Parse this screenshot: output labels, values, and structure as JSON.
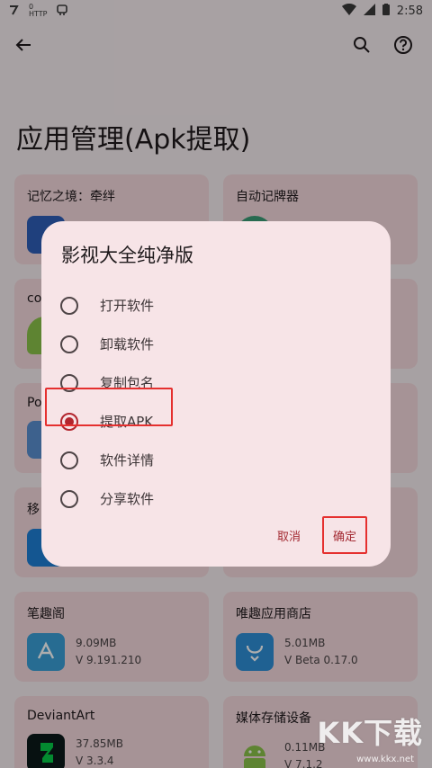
{
  "status_bar": {
    "time": "2:58",
    "left_icons": [
      "notification-icon",
      "net-speed-icon",
      "app-notif-icon"
    ],
    "net_speed": "0\nHTTP"
  },
  "app_bar": {
    "back_icon": "arrow-back-icon",
    "search_icon": "search-icon",
    "help_icon": "help-icon"
  },
  "page": {
    "title": "应用管理(Apk提取)"
  },
  "cards": [
    {
      "name": "记忆之境：牵绊",
      "size": "",
      "version": "",
      "icon_color": "#2f5fb8"
    },
    {
      "name": "自动记牌器",
      "size": "",
      "version": "",
      "icon_color": "#3a9c76"
    },
    {
      "name": "co",
      "size": "",
      "version": "",
      "icon_color": "#8bc34a"
    },
    {
      "name": "",
      "size": "",
      "version": "",
      "icon_color": "#8bc34a"
    },
    {
      "name": "Po",
      "size": "",
      "version": "",
      "icon_color": "#5b8fd0"
    },
    {
      "name": "",
      "size": "",
      "version": "",
      "icon_color": "#999"
    },
    {
      "name": "移",
      "size": "",
      "version": "",
      "icon_color": "#1e7fd6"
    },
    {
      "name": "",
      "size": "",
      "version": "",
      "icon_color": "#999"
    },
    {
      "name": "笔趣阁",
      "size": "9.09MB",
      "version": "V 9.191.210",
      "icon_color": "#3aa0d8"
    },
    {
      "name": "唯趣应用商店",
      "size": "5.01MB",
      "version": "V Beta 0.17.0",
      "icon_color": "#2f8fd8"
    },
    {
      "name": "DeviantArt",
      "size": "37.85MB",
      "version": "V 3.3.4",
      "icon_color": "#0b1a1a"
    },
    {
      "name": "媒体存储设备",
      "size": "0.11MB",
      "version": "V 7.1.2",
      "icon_color": "#8bc34a"
    }
  ],
  "dialog": {
    "title": "影视大全纯净版",
    "options": [
      {
        "label": "打开软件",
        "checked": false
      },
      {
        "label": "卸载软件",
        "checked": false
      },
      {
        "label": "复制包名",
        "checked": false
      },
      {
        "label": "提取APK",
        "checked": true
      },
      {
        "label": "软件详情",
        "checked": false
      },
      {
        "label": "分享软件",
        "checked": false
      }
    ],
    "cancel_label": "取消",
    "ok_label": "确定"
  },
  "colors": {
    "accent": "#b3262e",
    "card_bg": "#f5d9dd",
    "dialog_bg": "#f7e4e7",
    "highlight_box": "#e5302f"
  },
  "watermark": {
    "text": "KK下载",
    "url": "www.kkx.net"
  }
}
